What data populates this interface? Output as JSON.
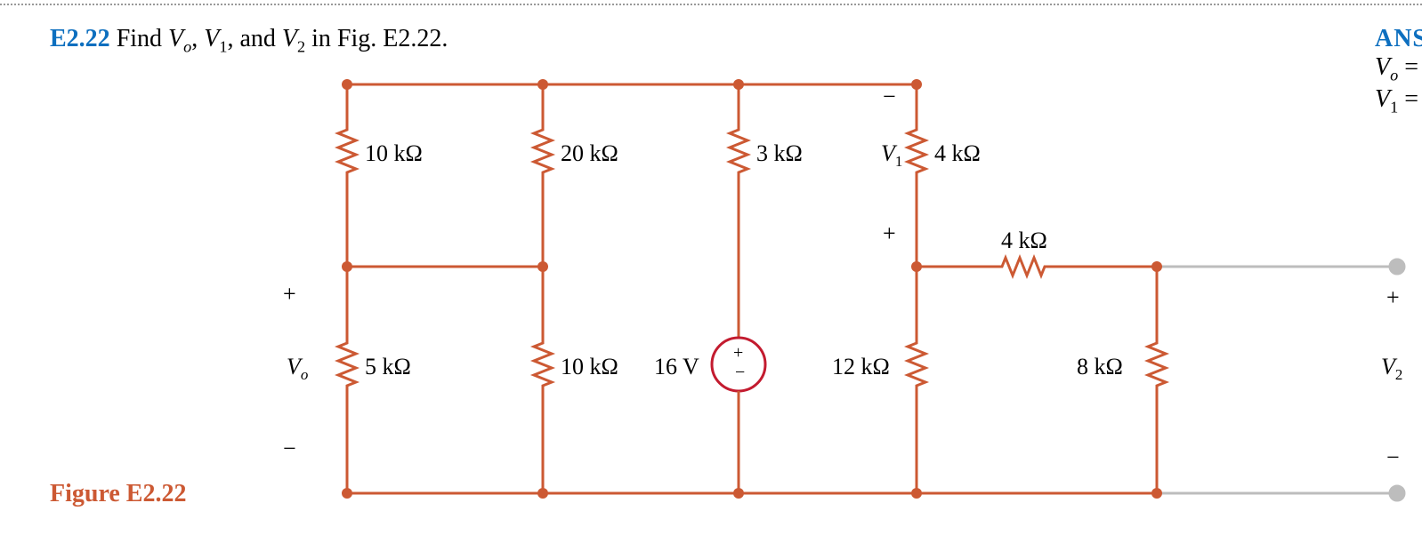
{
  "problem": {
    "id": "E2.22",
    "prompt_before": "Find ",
    "quant1": "V",
    "quant1sub": "o",
    "sep1": ", ",
    "quant2": "V",
    "quant2sub": "1",
    "sep2": ", and ",
    "quant3": "V",
    "quant3sub": "2",
    "prompt_after": " in Fig. E2.22."
  },
  "figure": {
    "caption": "Figure E2.22"
  },
  "answers": {
    "heading": "ANS",
    "line1": {
      "var": "V",
      "sub": "o",
      "eq": " ="
    },
    "line2": {
      "var": "V",
      "sub": "1",
      "eq": " ="
    }
  },
  "components": {
    "r10k_top": "10 kΩ",
    "r20k": "20 kΩ",
    "r3k": "3 kΩ",
    "r4k_top": "4 kΩ",
    "r4k_horiz": "4 kΩ",
    "r5k": "5 kΩ",
    "r10k_bot": "10 kΩ",
    "source": "16 V",
    "r12k": "12 kΩ",
    "r8k": "8 kΩ"
  },
  "markings": {
    "Vo": {
      "var": "V",
      "sub": "o"
    },
    "V1": {
      "var": "V",
      "sub": "1"
    },
    "V2": {
      "var": "V",
      "sub": "2"
    },
    "plus": "+",
    "minus": "−",
    "src_plus": "+",
    "src_minus": "−"
  }
}
